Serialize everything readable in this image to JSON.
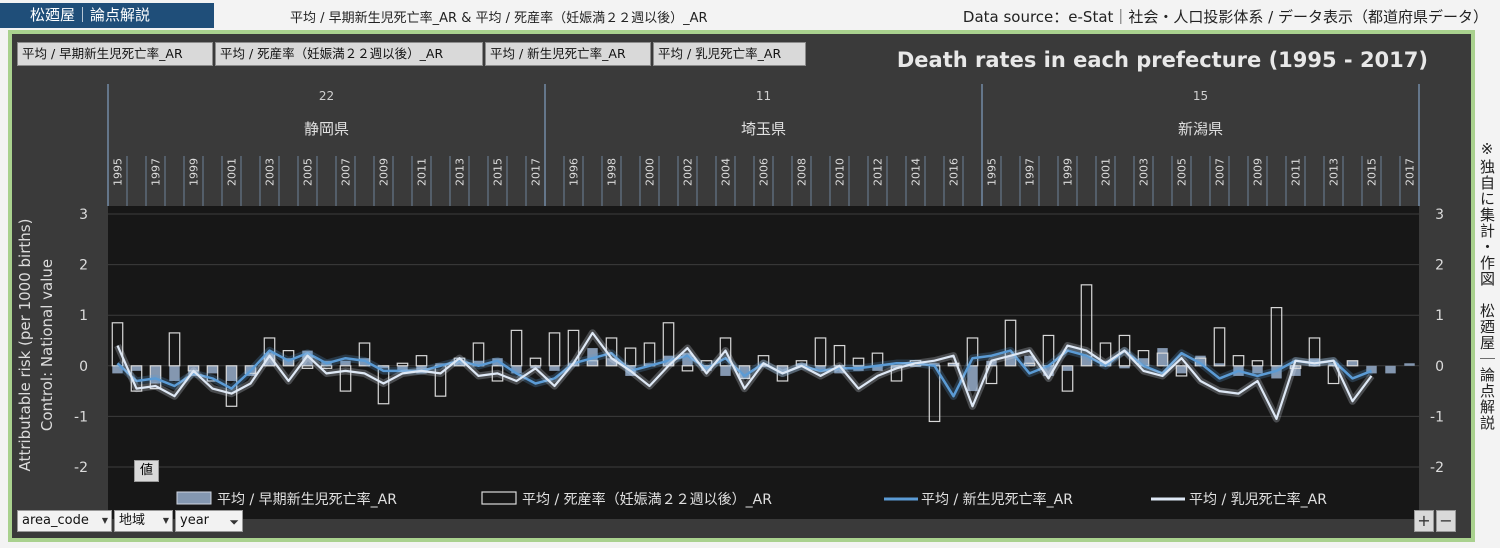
{
  "header": {
    "brand": "松廼屋｜論点解説",
    "subtitle": "平均 / 早期新生児死亡率_AR & 平均 / 死産率（妊娠満２２週以後）_AR",
    "source": "Data source：e-Stat｜社会・人口投影体系 / データ表示（都道府県データ）"
  },
  "tabs": [
    "平均 / 早期新生児死亡率_AR",
    "平均 / 死産率（妊娠満２２週以後）_AR",
    "平均 / 新生児死亡率_AR",
    "平均 / 乳児死亡率_AR"
  ],
  "side_note": "※独自に集計・作図　松廼屋｜論点解説",
  "controls": {
    "area_code": "area_code",
    "region": "地域",
    "year": "year",
    "value_button": "値",
    "plus": "+",
    "minus": "−"
  },
  "colors": {
    "bar_fill": "#8497b0",
    "bar_outline": "#d9d9d9",
    "neonatal": "#5b9bd5",
    "infant": "#dee8f5",
    "plot_bg": "#171717",
    "panel_bg": "#3a3a3a"
  },
  "chart_data": {
    "type": "bar",
    "title": "Death rates in each prefecture (1995 - 2017)",
    "ylabel": "Attributable risk (per 1000 births)",
    "ylabel2": "Control: National value",
    "ylim": [
      -2,
      3
    ],
    "yticks": [
      "3",
      "2",
      "1",
      "0",
      "-1",
      "-2"
    ],
    "grid": true,
    "legend_position": "bottom",
    "groups": [
      {
        "code": "22",
        "name": "静岡県",
        "year_labels": [
          "1995",
          "1997",
          "1999",
          "2001",
          "2003",
          "2005",
          "2007",
          "2009",
          "2011",
          "2013",
          "2015",
          "2017"
        ]
      },
      {
        "code": "11",
        "name": "埼玉県",
        "year_labels": [
          "1996",
          "1998",
          "2000",
          "2002",
          "2004",
          "2006",
          "2008",
          "2010",
          "2012",
          "2014",
          "2016"
        ]
      },
      {
        "code": "15",
        "name": "新潟県",
        "year_labels": [
          "1995",
          "1997",
          "1999",
          "2001",
          "2003",
          "2005",
          "2007",
          "2009",
          "2011",
          "2013",
          "2015",
          "2017"
        ]
      }
    ],
    "x": [
      "1995",
      "1996",
      "1997",
      "1998",
      "1999",
      "2000",
      "2001",
      "2002",
      "2003",
      "2004",
      "2005",
      "2006",
      "2007",
      "2008",
      "2009",
      "2010",
      "2011",
      "2012",
      "2013",
      "2014",
      "2015",
      "2016",
      "2017"
    ],
    "series": [
      {
        "name": "平均 / 早期新生児死亡率_AR",
        "kind": "bar-filled",
        "values": [
          -0.15,
          -0.1,
          -0.35,
          -0.3,
          -0.2,
          -0.15,
          -0.3,
          -0.2,
          0.25,
          0.15,
          0.3,
          0.1,
          0.1,
          0.15,
          -0.05,
          -0.1,
          -0.15,
          0.05,
          0.1,
          0.1,
          0.15,
          -0.15,
          -0.05,
          -0.1,
          0.05,
          0.35,
          0.15,
          -0.2,
          0.05,
          0.2,
          0.25,
          -0.1,
          -0.2,
          -0.25,
          0.0,
          -0.15,
          0.05,
          -0.1,
          -0.15,
          -0.1,
          -0.1,
          -0.05,
          0.0,
          0.05,
          0.05,
          -0.5,
          0.1,
          0.2,
          0.2,
          -0.2,
          -0.1,
          0.2,
          0.1,
          -0.05,
          0.15,
          0.35,
          -0.15,
          0.2,
          0.05,
          -0.2,
          -0.15,
          -0.25,
          -0.2,
          0.15,
          0.05,
          0.1,
          -0.15,
          -0.15,
          0.05
        ]
      },
      {
        "name": "平均 / 死産率（妊娠満２２週以後）_AR",
        "kind": "bar-outline",
        "values": [
          0.85,
          -0.5,
          -0.45,
          0.65,
          -0.1,
          -0.3,
          -0.8,
          -0.15,
          0.55,
          0.3,
          -0.05,
          -0.05,
          -0.5,
          0.45,
          -0.75,
          0.05,
          0.2,
          -0.6,
          0.15,
          0.45,
          -0.3,
          0.7,
          0.15,
          0.65,
          0.7,
          0.1,
          0.55,
          0.35,
          0.45,
          0.85,
          -0.1,
          0.1,
          0.55,
          -0.25,
          0.2,
          -0.3,
          0.1,
          0.55,
          0.4,
          0.15,
          0.25,
          -0.3,
          0.1,
          -1.1,
          0.05,
          0.55,
          -0.35,
          0.9,
          0.05,
          0.6,
          -0.5,
          1.6,
          0.45,
          0.6,
          0.3,
          0.25,
          -0.2,
          0.15,
          0.75,
          0.2,
          0.1,
          1.15,
          -0.05,
          0.55,
          -0.35,
          0.1
        ]
      },
      {
        "name": "平均 / 新生児死亡率_AR",
        "kind": "line",
        "values": [
          0.05,
          -0.3,
          -0.25,
          -0.4,
          -0.15,
          -0.25,
          -0.45,
          -0.1,
          0.3,
          0.1,
          0.25,
          0.05,
          0.15,
          0.1,
          -0.1,
          -0.1,
          -0.1,
          0.0,
          0.1,
          0.0,
          0.1,
          -0.15,
          -0.35,
          -0.25,
          0.05,
          0.15,
          0.25,
          -0.1,
          0.0,
          0.1,
          0.2,
          -0.05,
          0.15,
          -0.2,
          0.05,
          -0.15,
          0.0,
          -0.1,
          -0.05,
          -0.05,
          0.0,
          0.05,
          0.05,
          0.0,
          -0.6,
          0.15,
          0.2,
          0.3,
          -0.15,
          0.0,
          0.3,
          0.2,
          0.0,
          0.3,
          0.0,
          -0.15,
          0.25,
          0.05,
          -0.25,
          -0.1,
          -0.2,
          -0.1,
          0.1,
          0.05,
          0.1,
          -0.25,
          -0.1
        ]
      },
      {
        "name": "平均 / 乳児死亡率_AR",
        "kind": "line",
        "values": [
          0.4,
          -0.45,
          -0.4,
          -0.6,
          -0.1,
          -0.45,
          -0.55,
          -0.35,
          0.2,
          -0.3,
          0.2,
          -0.15,
          -0.1,
          -0.15,
          -0.35,
          -0.15,
          -0.1,
          -0.15,
          0.15,
          -0.2,
          -0.15,
          -0.3,
          -0.05,
          -0.4,
          0.05,
          0.65,
          0.15,
          -0.1,
          -0.4,
          0.0,
          0.35,
          -0.15,
          0.3,
          -0.45,
          0.05,
          -0.15,
          0.0,
          -0.2,
          0.0,
          -0.45,
          -0.2,
          -0.05,
          0.05,
          0.1,
          0.2,
          -0.8,
          0.1,
          0.2,
          0.3,
          -0.25,
          0.4,
          0.3,
          0.05,
          0.3,
          -0.1,
          -0.2,
          0.15,
          -0.3,
          -0.5,
          -0.55,
          -0.3,
          -1.05,
          0.1,
          0.05,
          0.1,
          -0.7,
          -0.2
        ]
      }
    ]
  }
}
